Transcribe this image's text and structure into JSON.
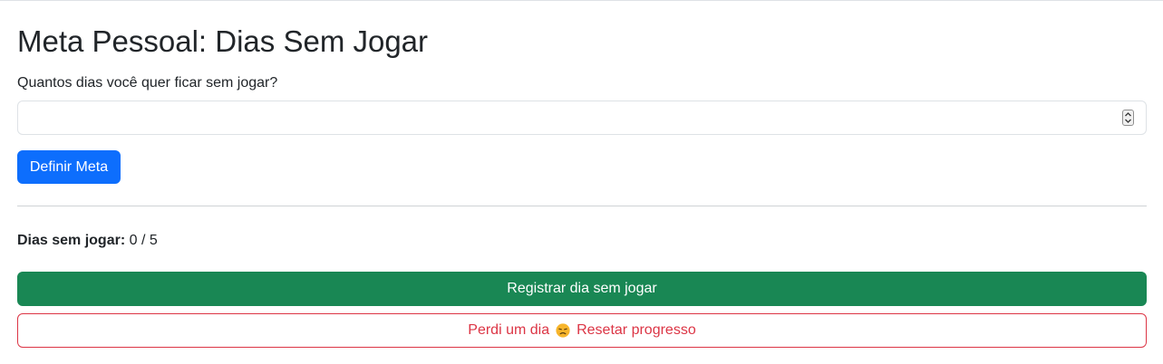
{
  "page": {
    "title": "Meta Pessoal: Dias Sem Jogar"
  },
  "goal_form": {
    "label": "Quantos dias você quer ficar sem jogar?",
    "input_value": "",
    "input_placeholder": "",
    "submit_label": "Definir Meta"
  },
  "progress": {
    "label": "Dias sem jogar:",
    "value": "0 / 5"
  },
  "actions": {
    "register_label": "Registrar dia sem jogar",
    "reset_prefix": "Perdi um dia",
    "reset_emoji": "disappointed-face-icon",
    "reset_suffix": "Resetar progresso"
  },
  "colors": {
    "primary": "#0d6efd",
    "success": "#198754",
    "danger": "#dc3545",
    "text": "#212529"
  }
}
